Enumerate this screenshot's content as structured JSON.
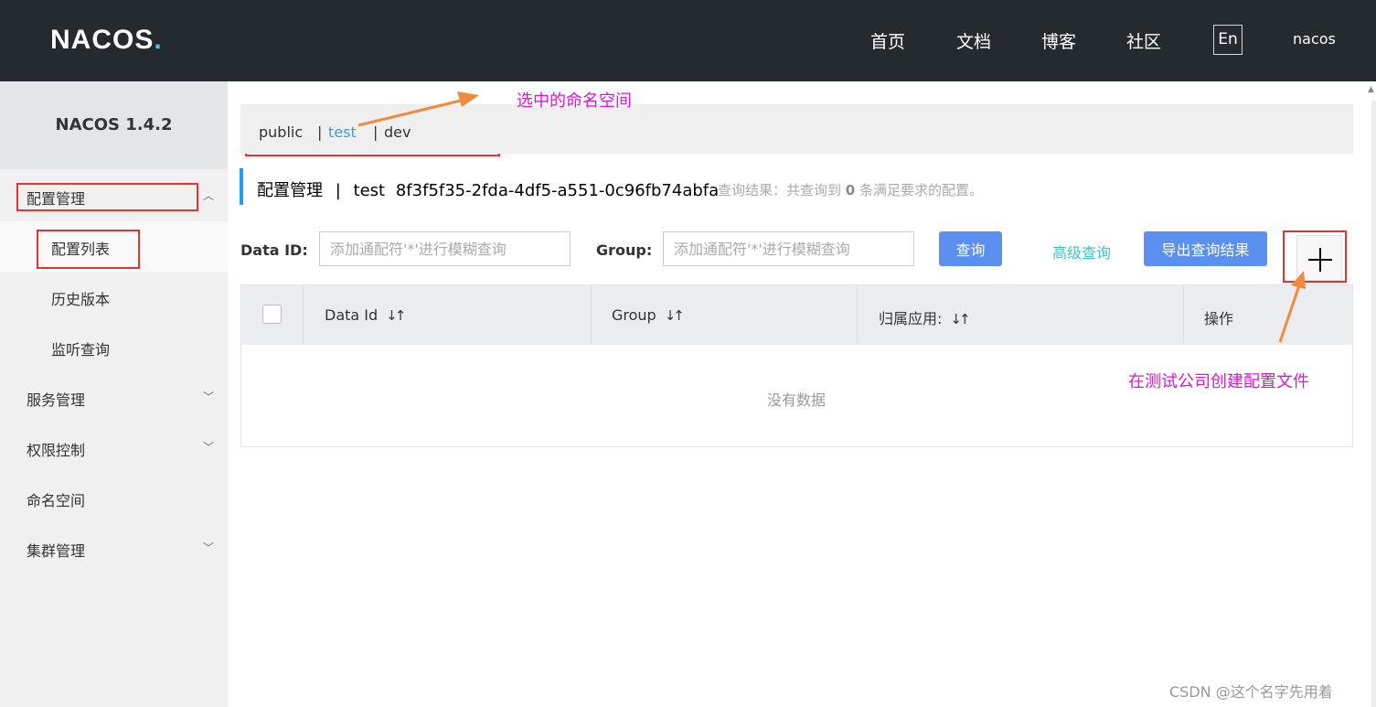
{
  "header": {
    "logo_text": "NACOS",
    "nav": [
      "首页",
      "文档",
      "博客",
      "社区"
    ],
    "lang": "En",
    "user": "nacos"
  },
  "sidebar": {
    "version": "NACOS 1.4.2",
    "config_mgmt": "配置管理",
    "config_list": "配置列表",
    "history": "历史版本",
    "listener": "监听查询",
    "service_mgmt": "服务管理",
    "permission": "权限控制",
    "namespace": "命名空间",
    "cluster": "集群管理"
  },
  "namespaces": {
    "public": "public",
    "sep": "|",
    "test": "test",
    "dev": "dev"
  },
  "title": {
    "section": "配置管理",
    "sep": "|",
    "ns_name": "test",
    "ns_id": "8f3f5f35-2fda-4df5-a551-0c96fb74abfa",
    "result_prefix": "查询结果：共查询到",
    "result_count": "0",
    "result_suffix": "条满足要求的配置。"
  },
  "search": {
    "data_id_label": "Data ID:",
    "data_id_placeholder": "添加通配符'*'进行模糊查询",
    "group_label": "Group:",
    "group_placeholder": "添加通配符'*'进行模糊查询",
    "query_button": "查询",
    "advanced_query": "高级查询",
    "export_button": "导出查询结果"
  },
  "table": {
    "columns": [
      "Data Id",
      "Group",
      "归属应用:",
      "操作"
    ],
    "sort_glyph": "↓↑",
    "empty": "没有数据"
  },
  "annotations": {
    "selected_namespace": "选中的命名空间",
    "create_config": "在测试公司创建配置文件"
  },
  "watermark": "CSDN @这个名字先用着",
  "colors": {
    "header_bg": "#252a2f",
    "primary": "#5c90f0",
    "link": "#42c0c7",
    "annotation": "#d418d4",
    "highlight_box": "#e53333",
    "arrow": "#f08a3c"
  }
}
